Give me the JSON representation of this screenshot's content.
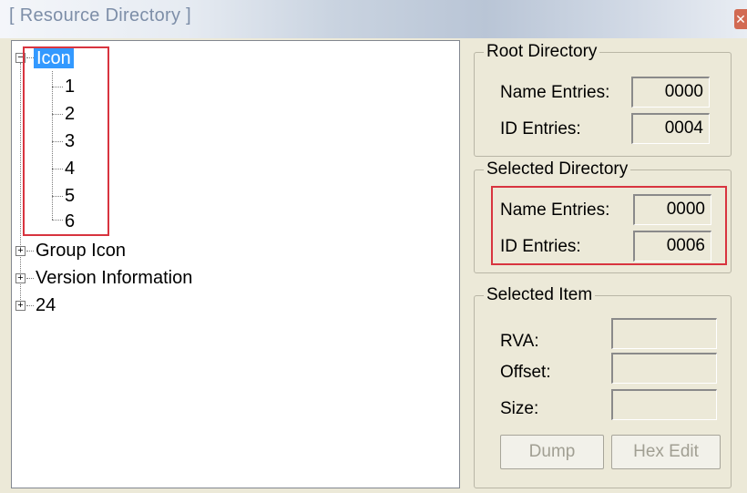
{
  "window": {
    "title": "[ Resource Directory ]"
  },
  "tree": {
    "items": [
      {
        "label": "Icon",
        "expanded": true,
        "selected": true,
        "children": [
          "1",
          "2",
          "3",
          "4",
          "5",
          "6"
        ]
      },
      {
        "label": "Group Icon",
        "expanded": false
      },
      {
        "label": "Version Information",
        "expanded": false
      },
      {
        "label": "24",
        "expanded": false
      }
    ]
  },
  "root_directory": {
    "title": "Root Directory",
    "name_entries_label": "Name Entries:",
    "name_entries": "0000",
    "id_entries_label": "ID Entries:",
    "id_entries": "0004"
  },
  "selected_directory": {
    "title": "Selected Directory",
    "name_entries_label": "Name Entries:",
    "name_entries": "0000",
    "id_entries_label": "ID Entries:",
    "id_entries": "0006"
  },
  "selected_item": {
    "title": "Selected Item",
    "rva_label": "RVA:",
    "rva": "",
    "offset_label": "Offset:",
    "offset": "",
    "size_label": "Size:",
    "size": "",
    "dump_label": "Dump",
    "hex_edit_label": "Hex Edit"
  },
  "colors": {
    "highlight": "#d8343f",
    "selection": "#3399ff"
  }
}
